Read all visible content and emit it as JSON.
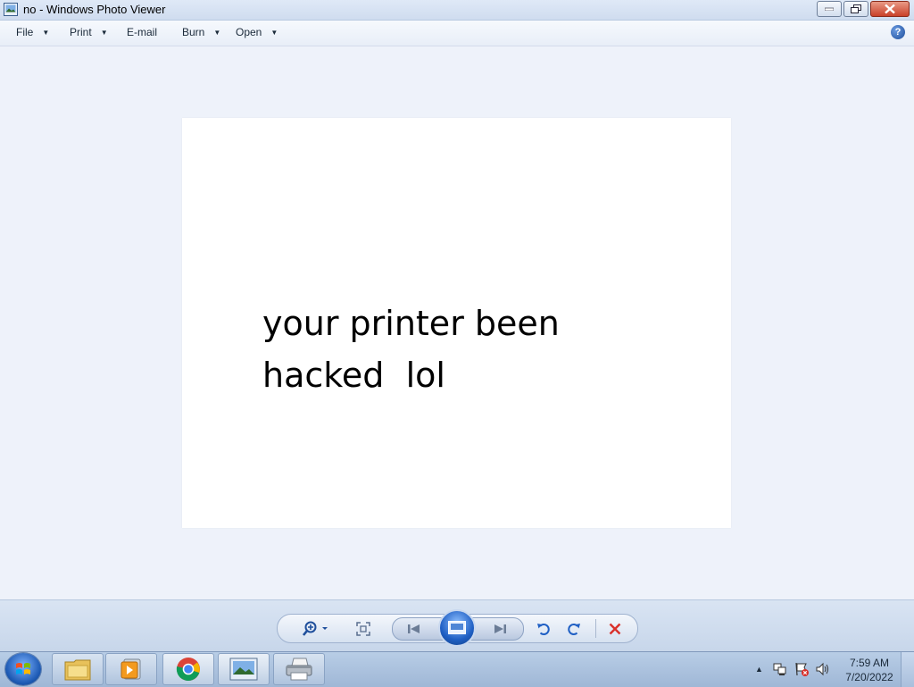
{
  "window": {
    "title": "no - Windows Photo Viewer"
  },
  "menu": {
    "file": "File",
    "print": "Print",
    "email": "E-mail",
    "burn": "Burn",
    "open": "Open",
    "dropdown_glyph": "▼",
    "help_glyph": "?"
  },
  "photo": {
    "line1": "your printer been",
    "line2": "hacked  lol"
  },
  "taskbar": {
    "time": "7:59 AM",
    "date": "7/20/2022"
  },
  "colors": {
    "accent": "#1f5fc4",
    "delete": "#d9302a"
  },
  "icons": [
    "photo-viewer-icon",
    "minimize-icon",
    "restore-icon",
    "close-icon",
    "help-icon",
    "zoom-icon",
    "actual-size-icon",
    "previous-icon",
    "slideshow-icon",
    "next-icon",
    "rotate-ccw-icon",
    "rotate-cw-icon",
    "delete-icon",
    "start-orb-icon",
    "file-explorer-icon",
    "media-player-icon",
    "chrome-icon",
    "photo-viewer-taskbar-icon",
    "printer-icon",
    "network-icon",
    "action-center-icon",
    "volume-icon"
  ]
}
